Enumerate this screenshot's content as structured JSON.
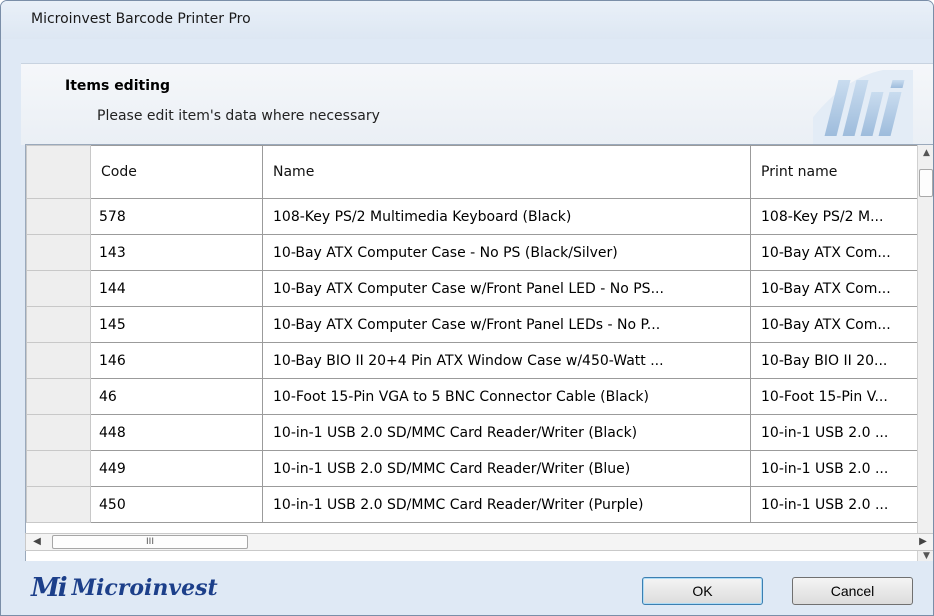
{
  "window": {
    "title": "Microinvest Barcode Printer Pro"
  },
  "banner": {
    "heading": "Items editing",
    "subtitle": "Please edit item's data where necessary"
  },
  "grid": {
    "columns": [
      "Code",
      "Name",
      "Print name"
    ],
    "rows": [
      [
        "578",
        "108-Key PS/2 Multimedia Keyboard (Black)",
        "108-Key PS/2 M..."
      ],
      [
        "143",
        "10-Bay ATX Computer Case - No PS (Black/Silver)",
        "10-Bay ATX Com..."
      ],
      [
        "144",
        "10-Bay ATX Computer Case w/Front Panel LED - No PS...",
        "10-Bay ATX Com..."
      ],
      [
        "145",
        "10-Bay ATX Computer Case w/Front Panel LEDs - No P...",
        "10-Bay ATX Com..."
      ],
      [
        "146",
        "10-Bay BIO II 20+4 Pin ATX Window Case w/450-Watt ...",
        "10-Bay BIO II 20..."
      ],
      [
        "46",
        "10-Foot 15-Pin VGA to 5 BNC Connector Cable (Black)",
        "10-Foot 15-Pin V..."
      ],
      [
        "448",
        "10-in-1 USB 2.0 SD/MMC Card Reader/Writer (Black)",
        "10-in-1 USB 2.0 ..."
      ],
      [
        "449",
        "10-in-1 USB 2.0 SD/MMC Card Reader/Writer (Blue)",
        "10-in-1 USB 2.0 ..."
      ],
      [
        "450",
        "10-in-1 USB 2.0 SD/MMC Card Reader/Writer (Purple)",
        "10-in-1 USB 2.0 ..."
      ]
    ]
  },
  "scrollbar": {
    "thumb_grip": "III"
  },
  "footer": {
    "brand_mark": "Mi",
    "brand_name": "Microinvest",
    "ok_label": "OK",
    "cancel_label": "Cancel"
  },
  "colors": {
    "brand": "#1c3f8a",
    "window_bg": "#dfe9f5"
  }
}
